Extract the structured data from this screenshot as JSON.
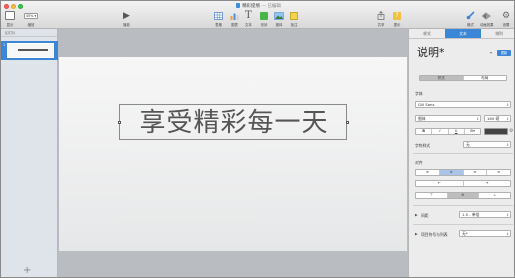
{
  "window": {
    "title": "精彩提纲",
    "subtitle": "— 已编辑"
  },
  "toolbar": {
    "view_label": "显示",
    "zoom_value": "45%",
    "zoom_label": "缩放",
    "play_label": "播放",
    "table_label": "表格",
    "chart_label": "图表",
    "text_label": "文本",
    "shape_label": "形状",
    "media_label": "媒体",
    "comment_label": "批注",
    "share_label": "共享",
    "tips_label": "提示",
    "format_label": "格式",
    "animate_label": "动画效果",
    "setup_label": "设置"
  },
  "navigator": {
    "header": "幻灯片",
    "slides": [
      {
        "number": "1"
      }
    ],
    "add_label": "+"
  },
  "slide": {
    "text": "享受精彩每一天"
  },
  "inspector": {
    "tabs": [
      {
        "label": "样式"
      },
      {
        "label": "文本"
      },
      {
        "label": "排列"
      }
    ],
    "style_name": "说明*",
    "update_label": "更新",
    "style_tabs": [
      "样式",
      "布局"
    ],
    "font_section": "字体",
    "font_family": "Gill Sans",
    "font_style": "细体",
    "font_size": "160 磅",
    "bold": "B",
    "italic": "I",
    "underline": "U",
    "gear": "⚙▾",
    "char_style_label": "字符样式",
    "char_style_value": "无",
    "align_section": "对齐",
    "indent_less": "⇤",
    "indent_more": "⇥",
    "spacing_label": "间距",
    "spacing_value": "1.0 - 单倍",
    "bullets_label": "项目符号与列表",
    "bullets_value": "无*"
  },
  "colors": {
    "accent": "#3b86d6",
    "text_color_swatch": "#444444"
  }
}
